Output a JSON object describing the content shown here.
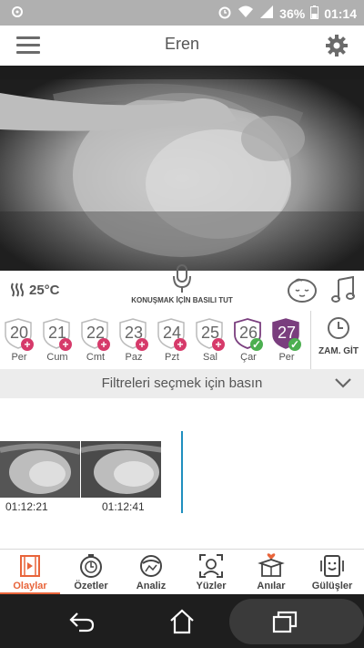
{
  "status_bar": {
    "battery": "36%",
    "time": "01:14"
  },
  "header": {
    "title": "Eren"
  },
  "controls": {
    "temperature": "25°C",
    "talk_label": "KONUŞMAK İÇİN BASILI TUT"
  },
  "days": [
    {
      "num": "20",
      "label": "Per",
      "status": "plus"
    },
    {
      "num": "21",
      "label": "Cum",
      "status": "plus"
    },
    {
      "num": "22",
      "label": "Cmt",
      "status": "plus"
    },
    {
      "num": "23",
      "label": "Paz",
      "status": "plus"
    },
    {
      "num": "24",
      "label": "Pzt",
      "status": "plus"
    },
    {
      "num": "25",
      "label": "Sal",
      "status": "plus"
    },
    {
      "num": "26",
      "label": "Çar",
      "status": "check"
    },
    {
      "num": "27",
      "label": "Per",
      "status": "check",
      "selected": true
    }
  ],
  "goto_label": "ZAM. GİT",
  "filter": {
    "text": "Filtreleri seçmek için basın"
  },
  "clips": [
    {
      "time": "01:12:21"
    },
    {
      "time": "01:12:41"
    }
  ],
  "bottom_nav": [
    {
      "label": "Olaylar",
      "icon": "film-icon",
      "active": true
    },
    {
      "label": "Özetler",
      "icon": "timer-icon"
    },
    {
      "label": "Analiz",
      "icon": "chart-icon"
    },
    {
      "label": "Yüzler",
      "icon": "face-scan-icon"
    },
    {
      "label": "Anılar",
      "icon": "memory-box-icon"
    },
    {
      "label": "Gülüşler",
      "icon": "smile-icon"
    }
  ],
  "colors": {
    "accent": "#e8643a",
    "plus_badge": "#d63a6a",
    "check_badge": "#4caf50",
    "selected_day": "#7a3e7e",
    "playhead": "#1f8fbf"
  }
}
